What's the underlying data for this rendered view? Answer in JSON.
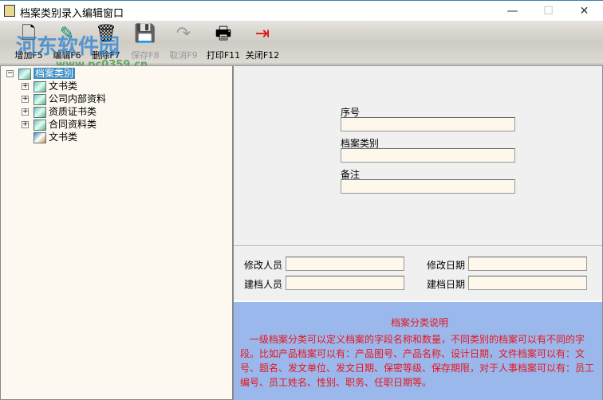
{
  "window": {
    "title": "档案类别录入编辑窗口",
    "minimize": "—",
    "maximize": "☐",
    "close": "✕"
  },
  "watermark": {
    "name": "河东软件园",
    "url": "www.pc0359.cn"
  },
  "toolbar": [
    {
      "label": "增加F5",
      "icon": "add-icon",
      "glyph": "🗋",
      "enabled": true
    },
    {
      "label": "编辑F6",
      "icon": "edit-icon",
      "glyph": "✎",
      "enabled": true
    },
    {
      "label": "删除F7",
      "icon": "delete-icon",
      "glyph": "🗑",
      "enabled": true
    },
    {
      "label": "保存F8",
      "icon": "save-icon",
      "glyph": "💾",
      "enabled": false
    },
    {
      "label": "取消F9",
      "icon": "undo-icon",
      "glyph": "↷",
      "enabled": false
    },
    {
      "label": "打印F11",
      "icon": "print-icon",
      "glyph": "🖶",
      "enabled": true
    },
    {
      "label": "关闭F12",
      "icon": "exit-door-icon",
      "glyph": "⇥",
      "enabled": true
    }
  ],
  "tree": {
    "root": "档案类别",
    "children": [
      "文书类",
      "公司内部资料",
      "资质证书类",
      "合同资料类",
      "文书类"
    ]
  },
  "form": {
    "seq_label": "序号",
    "seq_value": "",
    "category_label": "档案类别",
    "category_value": "",
    "note_label": "备注",
    "note_value": "",
    "modified_by_label": "修改人员",
    "modified_by": "",
    "modified_date_label": "修改日期",
    "modified_date": "",
    "created_by_label": "建档人员",
    "created_by": "",
    "created_date_label": "建档日期",
    "created_date": ""
  },
  "description": {
    "title": "档案分类说明",
    "text": "　一级档案分类可以定义档案的字段名称和数量，不同类别的档案可以有不同的字段。比如产品档案可以有：产品图号、产品名称、设计日期，文件档案可以有：文号、题名、发文单位、发文日期、保密等级、保存期限，对于人事档案可以有：员工编号、员工姓名、性别、职务、任职日期等。"
  }
}
